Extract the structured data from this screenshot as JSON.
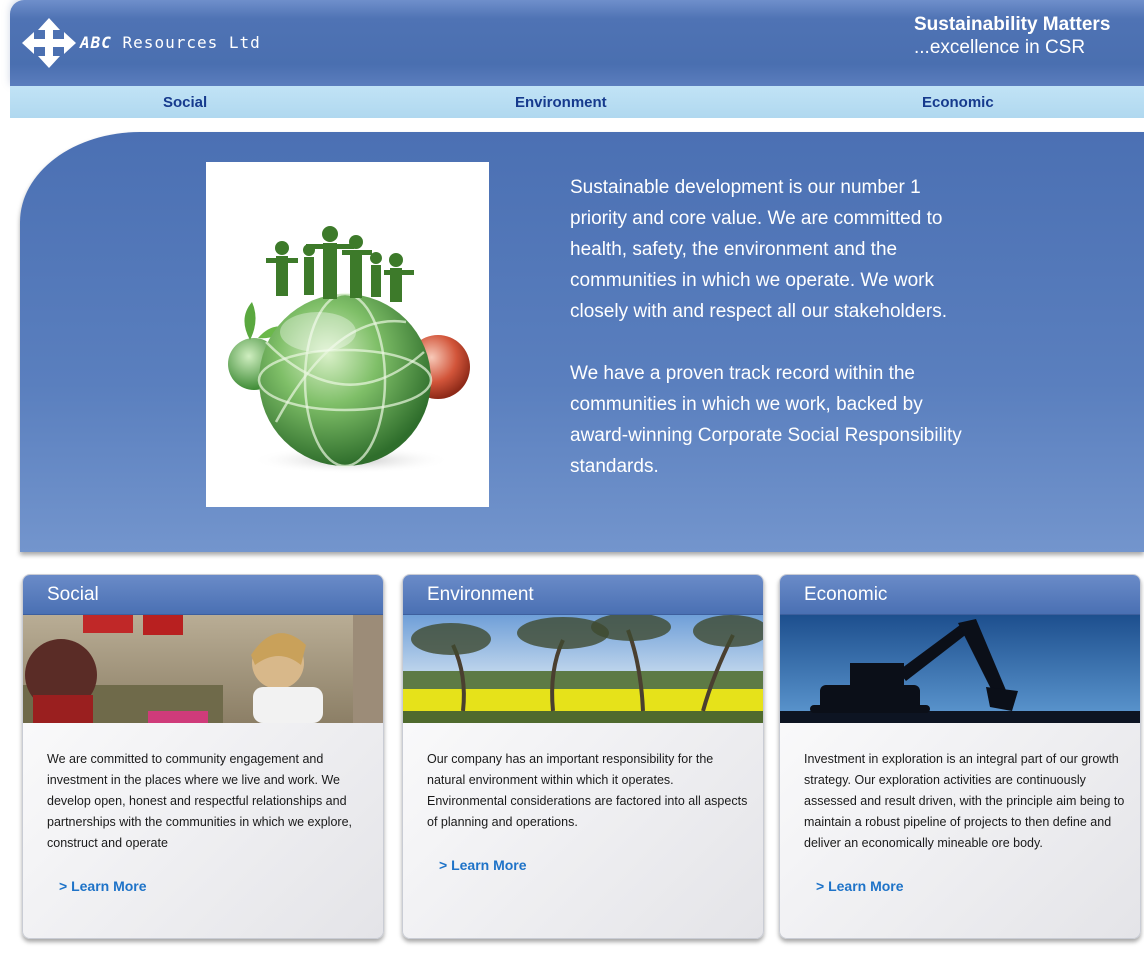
{
  "header": {
    "brand_abbr": "ABC",
    "brand_rest": " Resources Ltd",
    "tagline_title": "Sustainability Matters",
    "tagline_sub": "...excellence in CSR",
    "colors": {
      "header_blue": "#4a6fb0",
      "nav_light_blue": "#b4daf0",
      "nav_text": "#163a8d"
    }
  },
  "nav": {
    "items": [
      {
        "label": "Social"
      },
      {
        "label": "Environment"
      },
      {
        "label": "Economic"
      }
    ]
  },
  "hero": {
    "image_icon": "globe-people-icon",
    "paragraph_1": "Sustainable development is our number 1 priority and core value. We are committed to health, safety, the environment and the communities in which we operate. We work closely with and respect all our stakeholders.",
    "paragraph_2": "We have a proven track record within the communities in which we work, backed by award-winning Corporate Social Responsibility standards."
  },
  "cards": [
    {
      "title": "Social",
      "photo": "children-playing-photo",
      "text": "We are committed to community engagement and investment in the places where we live and work. We develop open, honest and respectful relationships and partnerships with the communities in which we explore, construct and operate",
      "link": "> Learn More"
    },
    {
      "title": "Environment",
      "photo": "eucalyptus-canola-field-photo",
      "text": "Our company has an important responsibility for the natural environment within which it operates. Environmental considerations are factored into all aspects of planning and operations.",
      "link": "> Learn More"
    },
    {
      "title": "Economic",
      "photo": "excavator-silhouette-photo",
      "text": "Investment in exploration is an integral part of our growth strategy. Our exploration activities are continuously assessed and result driven, with the principle aim being to maintain a robust pipeline of projects to then define and deliver an economically mineable ore body.",
      "link": "> Learn More"
    }
  ]
}
